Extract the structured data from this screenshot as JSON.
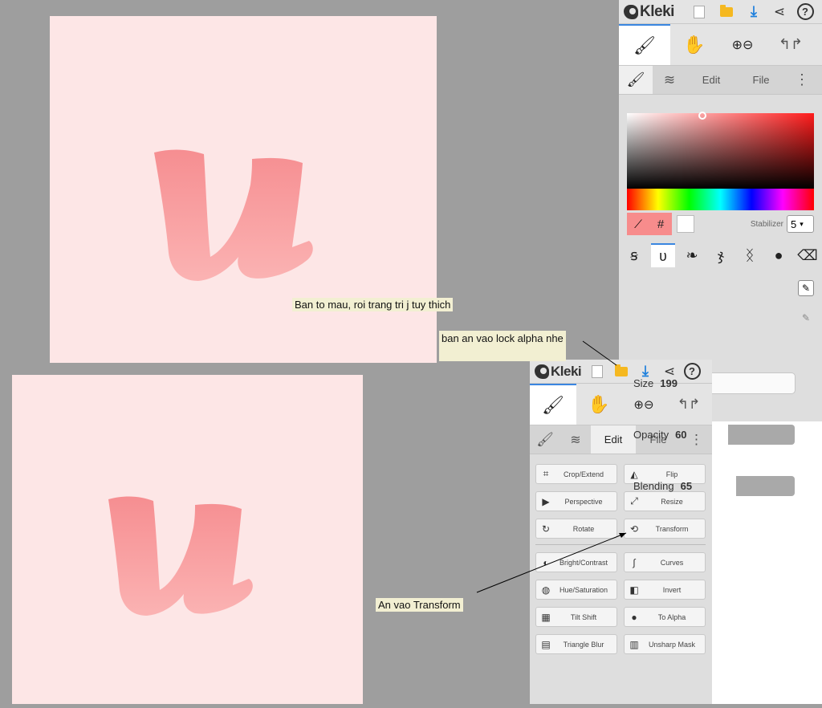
{
  "app": {
    "name": "Kleki"
  },
  "top_panel": {
    "tabs": {
      "edit": "Edit",
      "file": "File"
    },
    "stabilizer": {
      "label": "Stabilizer",
      "value": "5"
    },
    "sliders": {
      "size": {
        "label": "Size",
        "value": "199"
      },
      "opacity": {
        "label": "Opacity",
        "value": "60",
        "fraction": 0.6
      },
      "blending": {
        "label": "Blending",
        "value": "65",
        "fraction": 0.65
      }
    },
    "hex_symbol": "#"
  },
  "bottom_panel": {
    "tabs": {
      "edit": "Edit",
      "file": "File"
    },
    "edit_buttons": [
      {
        "label": "Crop/Extend",
        "icon": "crop-icon"
      },
      {
        "label": "Flip",
        "icon": "flip-icon"
      },
      {
        "label": "Perspective",
        "icon": "perspective-icon"
      },
      {
        "label": "Resize",
        "icon": "resize-icon"
      },
      {
        "label": "Rotate",
        "icon": "rotate-icon"
      },
      {
        "label": "Transform",
        "icon": "transform-icon"
      },
      {
        "label": "Bright/Contrast",
        "icon": "brightness-icon"
      },
      {
        "label": "Curves",
        "icon": "curves-icon"
      },
      {
        "label": "Hue/Saturation",
        "icon": "hue-icon"
      },
      {
        "label": "Invert",
        "icon": "invert-icon"
      },
      {
        "label": "Tilt Shift",
        "icon": "tilt-shift-icon"
      },
      {
        "label": "To Alpha",
        "icon": "to-alpha-icon"
      },
      {
        "label": "Triangle Blur",
        "icon": "blur-icon"
      },
      {
        "label": "Unsharp Mask",
        "icon": "unsharp-icon"
      }
    ]
  },
  "canvas": {
    "letter": "u",
    "color": "#f7999b",
    "bg": "#fde6e6"
  },
  "annotations": {
    "note1": "Ban to mau, roi trang tri j tuy thich",
    "note2": "ban an vao lock alpha nhe",
    "note3": "An vao Transform"
  }
}
